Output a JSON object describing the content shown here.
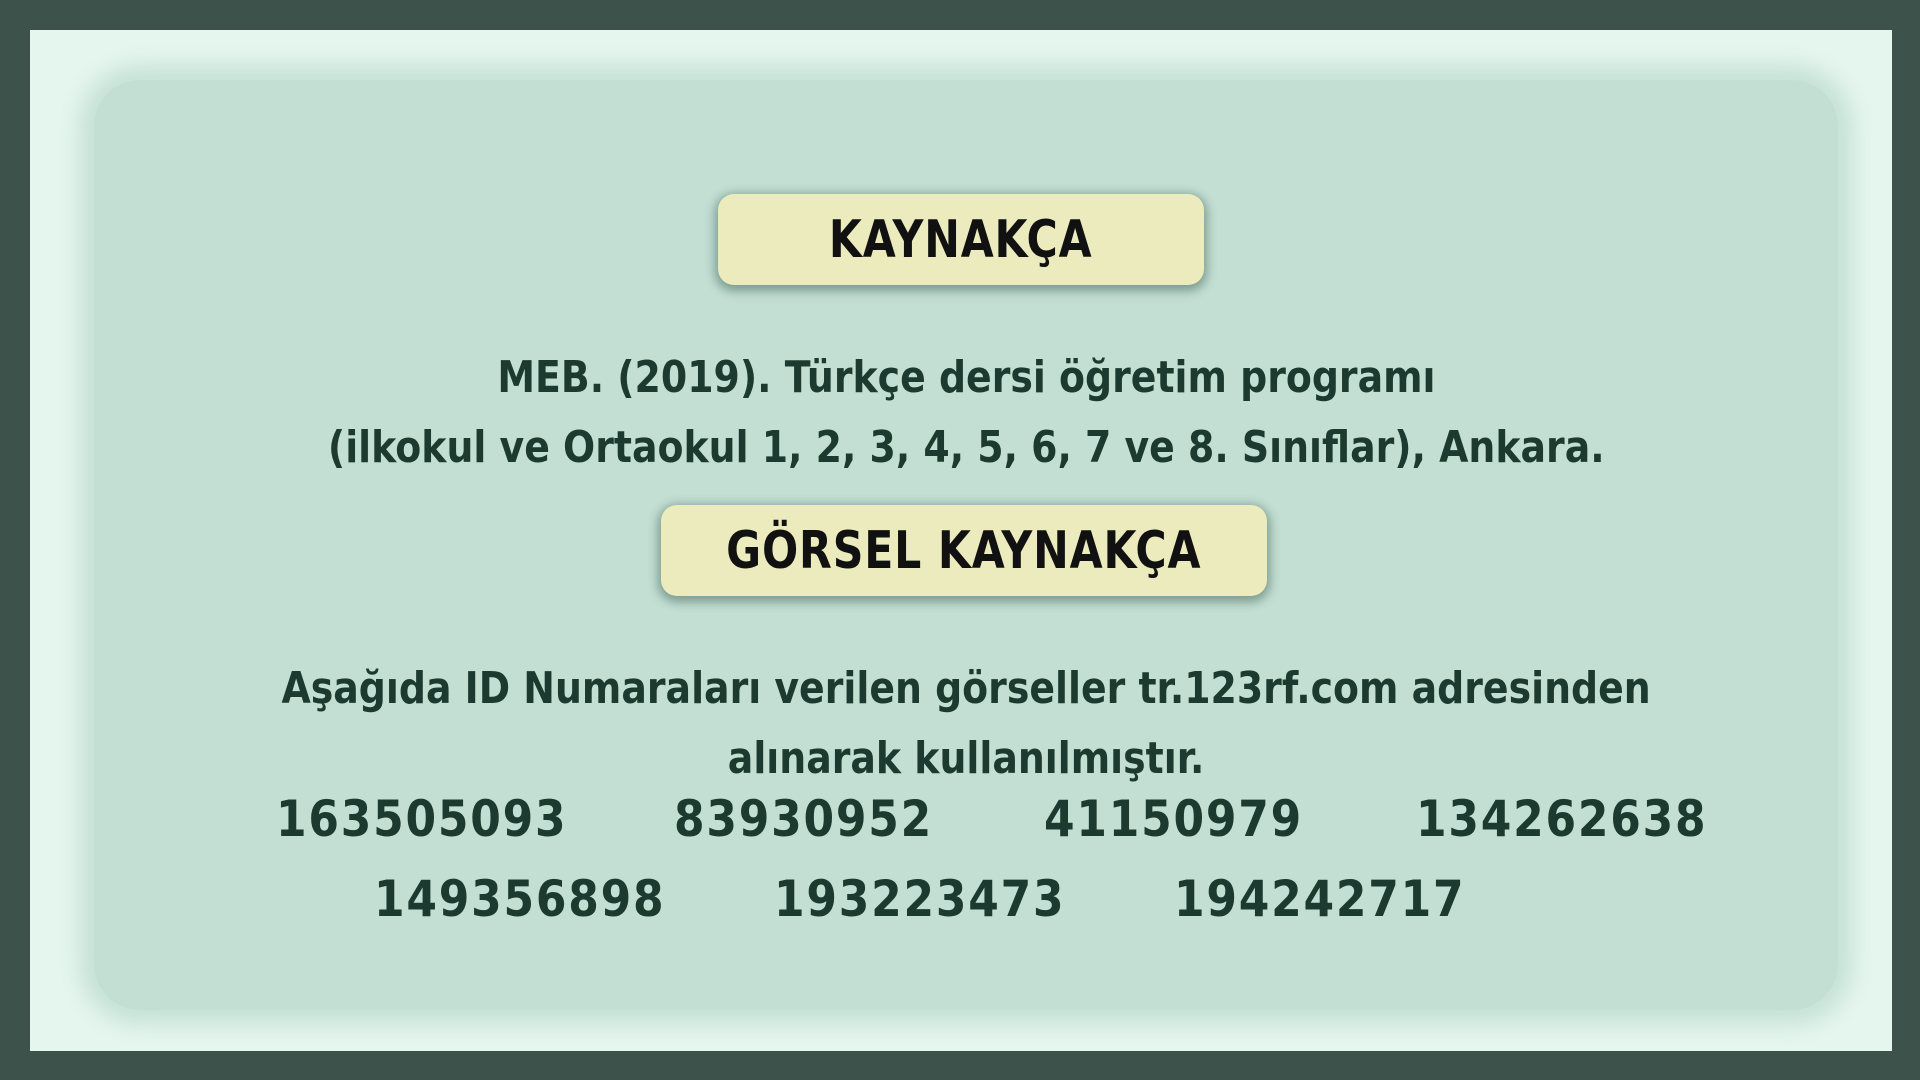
{
  "headings": {
    "references": "KAYNAKÇA",
    "image_references": "GÖRSEL KAYNAKÇA"
  },
  "reference": {
    "line1": "MEB. (2019). Türkçe dersi öğretim programı",
    "line2": "(ilkokul ve Ortaokul  1, 2, 3, 4, 5, 6, 7 ve 8. Sınıflar), Ankara."
  },
  "image_note": {
    "line1": "Aşağıda ID Numaraları verilen görseller tr.123rf.com adresinden",
    "line2": "alınarak kullanılmıştır."
  },
  "image_ids": [
    "163505093",
    "83930952",
    "41150979",
    "134262638",
    "149356898",
    "193223473",
    "194242717"
  ],
  "colors": {
    "outer_border": "#3c524b",
    "frame": "#e5f6ef",
    "panel": "#c3dfd4",
    "heading_box": "#ebebbd",
    "text": "#1c3a30"
  }
}
